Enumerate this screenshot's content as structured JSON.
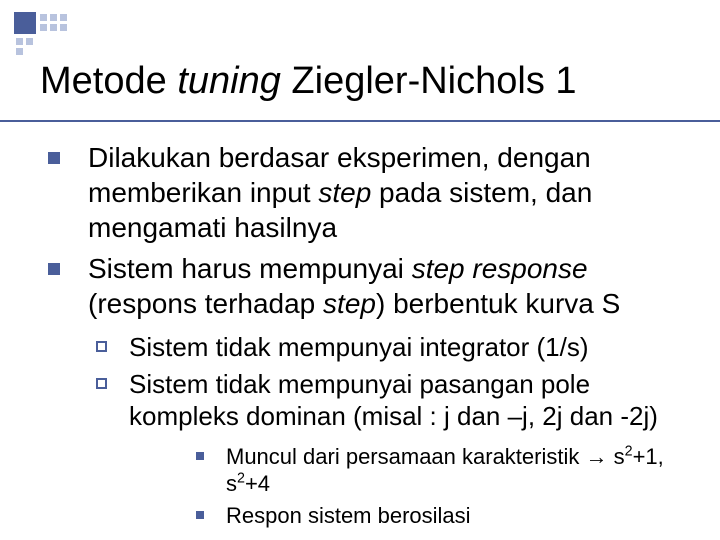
{
  "title": {
    "part1": "Metode ",
    "italic": "tuning",
    "part2": " Ziegler-Nichols 1"
  },
  "bullets": [
    {
      "segments": [
        {
          "t": "Dilakukan berdasar eksperimen, dengan memberikan input "
        },
        {
          "t": "step",
          "i": true
        },
        {
          "t": " pada sistem, dan mengamati hasilnya"
        }
      ]
    },
    {
      "segments": [
        {
          "t": "Sistem harus mempunyai "
        },
        {
          "t": "step response",
          "i": true
        },
        {
          "t": " (respons terhadap "
        },
        {
          "t": "step",
          "i": true
        },
        {
          "t": ") berbentuk kurva S"
        }
      ]
    }
  ],
  "sub": [
    {
      "segments": [
        {
          "t": "Sistem tidak mempunyai integrator (1/s)"
        }
      ]
    },
    {
      "segments": [
        {
          "t": "Sistem tidak mempunyai pasangan pole kompleks dominan (misal : j dan –j, 2j dan -2j)"
        }
      ]
    }
  ],
  "subsub": [
    {
      "segments": [
        {
          "t": "Muncul dari persamaan karakteristik "
        },
        {
          "arrow": true
        },
        {
          "t": " s"
        },
        {
          "sup": "2"
        },
        {
          "t": "+1, s"
        },
        {
          "sup": "2"
        },
        {
          "t": "+4"
        }
      ]
    },
    {
      "segments": [
        {
          "t": "Respon sistem berosilasi"
        }
      ]
    }
  ]
}
